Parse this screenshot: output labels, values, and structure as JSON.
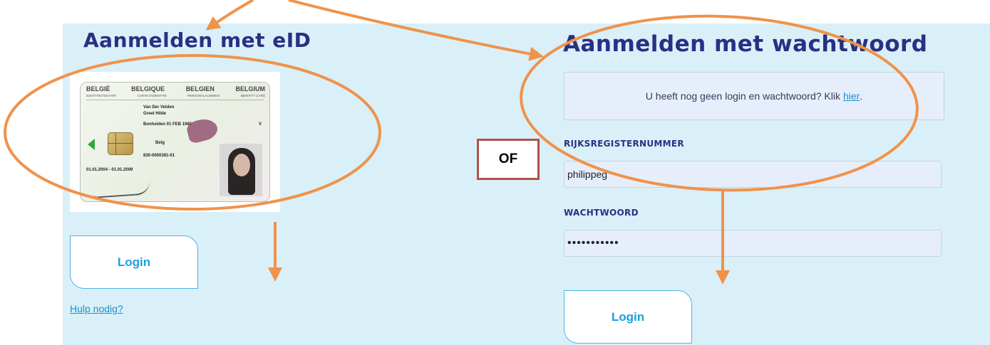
{
  "eid_section": {
    "title": "Aanmelden met eID",
    "login_label": "Login",
    "help_link": "Hulp nodig?",
    "card": {
      "countries": [
        "BELGIË",
        "BELGIQUE",
        "BELGIEN",
        "BELGIUM"
      ],
      "subtitles": [
        "IDENTITEITSKAART",
        "CARTE D'IDENTITE",
        "PERSONALAUSWEIS",
        "IDENTITY CARD"
      ],
      "surname": "Van Der Velden",
      "given_names": "Greet Hilde",
      "birth": "Bonheiden 01 FEB 1985",
      "sex": "V",
      "nationality": "Belg",
      "card_no": "830-0000381-01",
      "validity": "01.01.2004 - 01.01.2009"
    }
  },
  "or_label": "OF",
  "password_section": {
    "title": "Aanmelden met wachtwoord",
    "info_text": "U heeft nog geen login en wachtwoord? Klik",
    "info_link": "hier",
    "info_suffix": ".",
    "rrn_label": "RIJKSREGISTERNUMMER",
    "rrn_value": "philippeg",
    "password_label": "WACHTWOORD",
    "password_value": "•••••••••••",
    "login_label": "Login"
  },
  "annotation_color": "#f0924a",
  "panel_color": "#d9f0f8",
  "accent_color": "#1aa0dd"
}
